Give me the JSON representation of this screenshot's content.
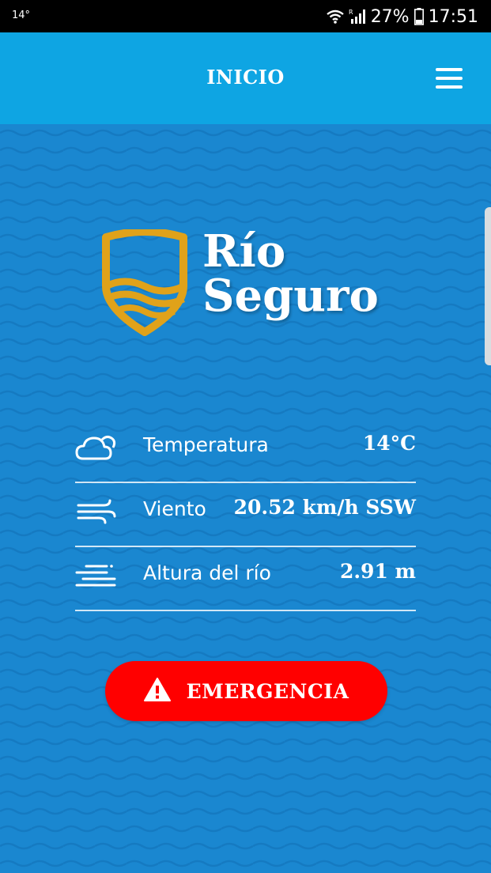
{
  "status_bar": {
    "temperature": "14°",
    "battery": "27%",
    "time": "17:51"
  },
  "header": {
    "title": "INICIO"
  },
  "logo": {
    "line1": "Río",
    "line2": "Seguro"
  },
  "metrics": [
    {
      "icon": "cloud-icon",
      "label": "Temperatura",
      "value": "14°C"
    },
    {
      "icon": "wind-icon",
      "label": "Viento",
      "value": "20.52 km/h SSW"
    },
    {
      "icon": "river-level-icon",
      "label": "Altura del río",
      "value": "2.91 m"
    }
  ],
  "emergency": {
    "label": "EMERGENCIA",
    "icon": "warning-icon"
  },
  "colors": {
    "header_bg": "#0ea5e3",
    "content_bg": "#1a87d0",
    "emergency_bg": "#ff0000",
    "logo_gold": "#e0a21a"
  }
}
